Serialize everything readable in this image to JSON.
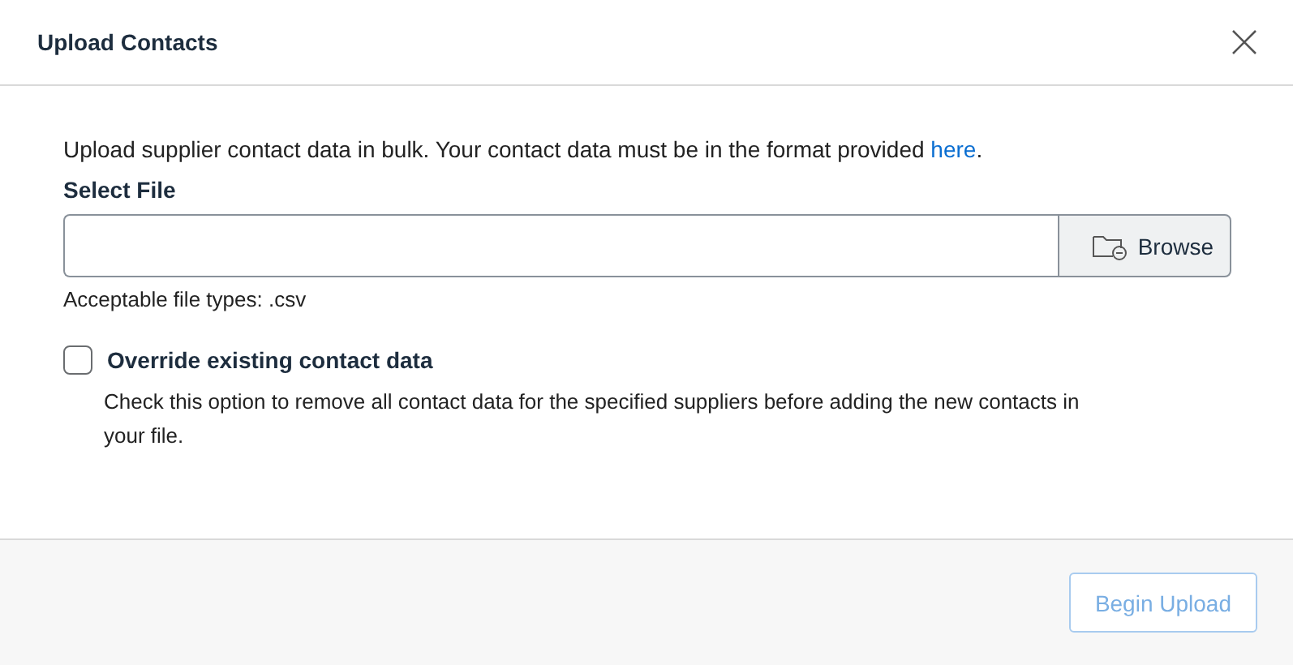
{
  "dialog": {
    "title": "Upload Contacts"
  },
  "description": {
    "text": "Upload supplier contact data in bulk. Your contact data must be in the format provided ",
    "link": "here",
    "after": "."
  },
  "file_field": {
    "label": "Select File",
    "button": "Browse",
    "hint": "Acceptable file types: .csv"
  },
  "override": {
    "label": "Override existing contact data",
    "checked": false,
    "help": "Check this option to remove all contact data for the specified suppliers before adding the new contacts in your file."
  },
  "footer": {
    "button": {
      "label": "Begin Upload",
      "disabled": true
    }
  }
}
